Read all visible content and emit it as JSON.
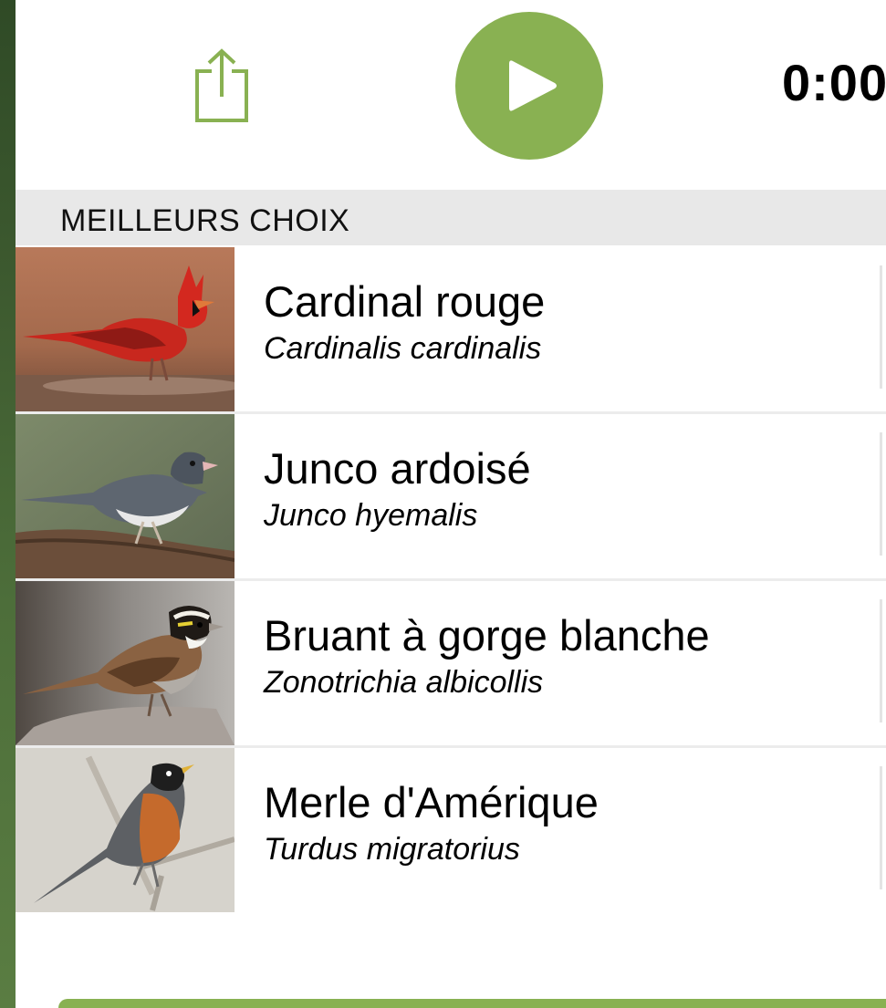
{
  "toolbar": {
    "share_icon": "share-icon",
    "play_icon": "play-icon",
    "time": "0:00"
  },
  "colors": {
    "accent": "#89b152",
    "header_bg": "#e8e8e8",
    "sidebar_edge": "#3e5b30"
  },
  "section": {
    "title": "MEILLEURS CHOIX"
  },
  "species": [
    {
      "common": "Cardinal rouge",
      "scientific": "Cardinalis cardinalis"
    },
    {
      "common": "Junco ardoisé",
      "scientific": "Junco hyemalis"
    },
    {
      "common": "Bruant à gorge blanche",
      "scientific": "Zonotrichia albicollis"
    },
    {
      "common": "Merle d'Amérique",
      "scientific": "Turdus migratorius"
    }
  ]
}
